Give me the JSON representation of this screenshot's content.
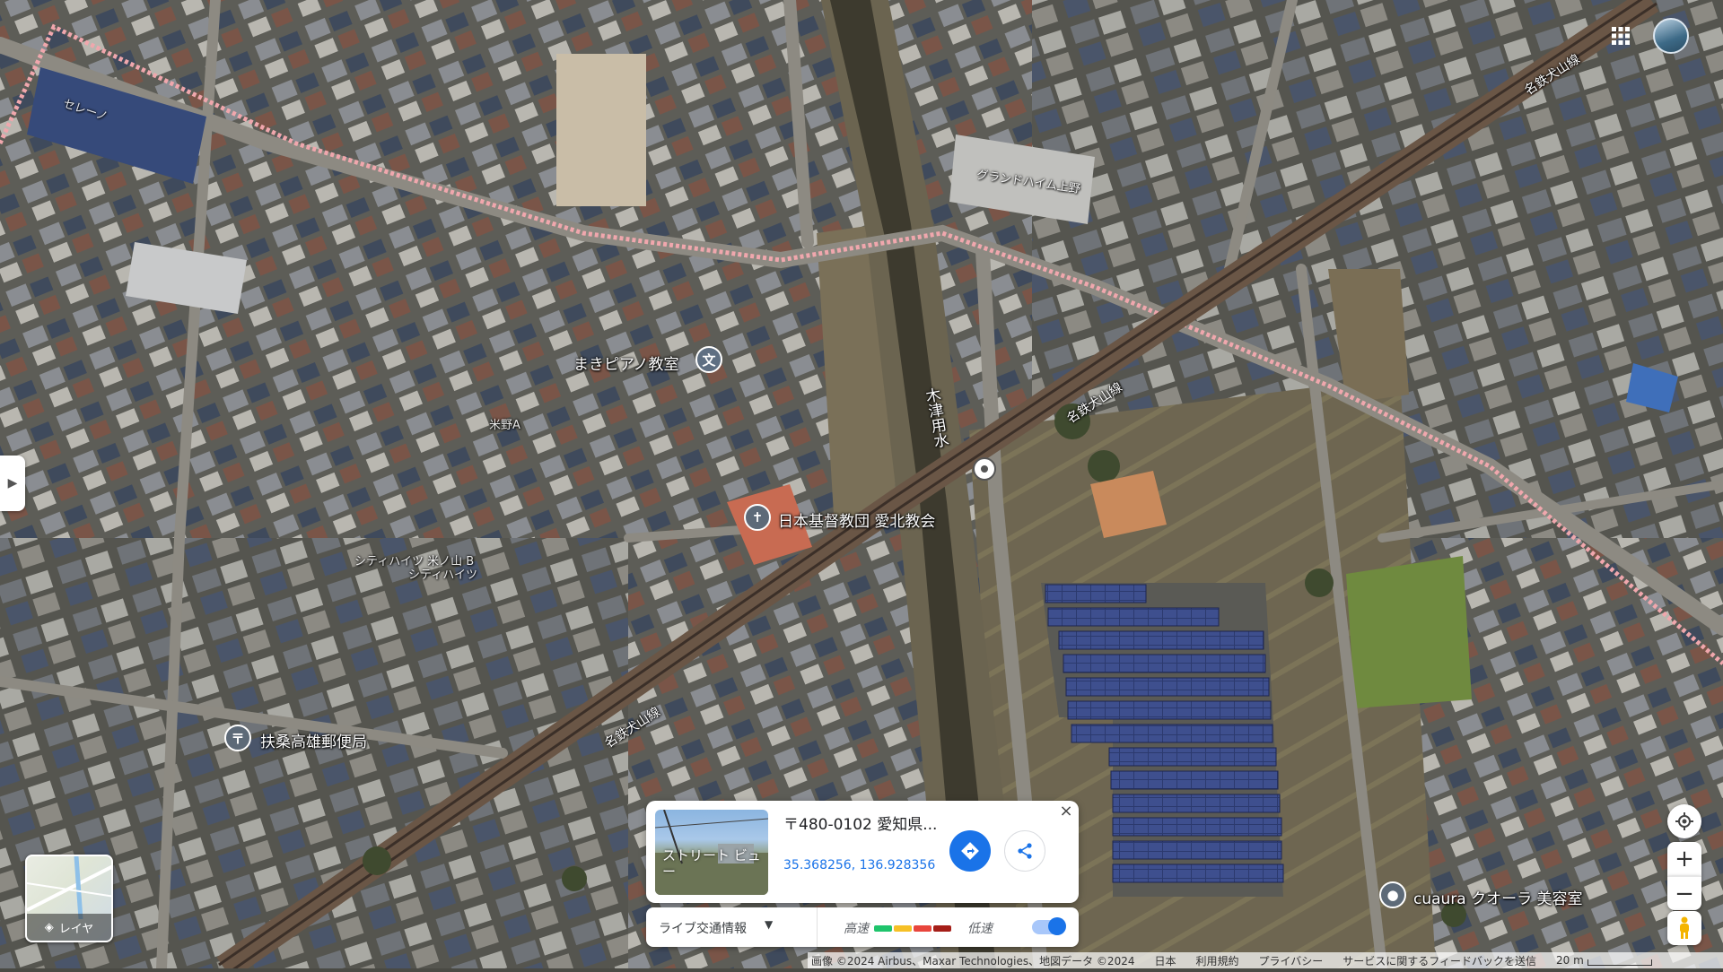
{
  "map": {
    "type": "satellite",
    "labels": {
      "piano_school": "まきピアノ教室",
      "church": "日本基督教団 愛北教会",
      "post_office": "扶桑高雄郵便局",
      "salon": "cuaura クオーラ 美容室",
      "canal": "木津用水",
      "rail_line_1": "名鉄犬山線",
      "rail_line_2": "名鉄犬山線",
      "rail_line_3": "名鉄犬山線",
      "building_1": "グランドハイム上野",
      "building_2": "シティハイツ 米ノ山 B",
      "building_3": "セレーノ",
      "building_4": "米野A",
      "building_5": "シティハイツ"
    },
    "icons": {
      "school": "school-icon",
      "church": "cross-icon",
      "post": "post-office-icon",
      "salon": "pin-icon"
    }
  },
  "info_card": {
    "address": "〒480-0102 愛知県...",
    "coordinates": "35.368256, 136.928356",
    "street_view_label": "ストリート ビュー",
    "close_label": "×"
  },
  "traffic": {
    "label": "ライブ交通情報",
    "fast": "高速",
    "slow": "低速",
    "colors": [
      "#1fc46c",
      "#f6c026",
      "#e8453c",
      "#a51e18"
    ],
    "enabled": true
  },
  "layers": {
    "label": "レイヤ"
  },
  "footer": {
    "attribution": "画像 ©2024 Airbus、Maxar Technologies、地図データ ©2024",
    "country": "日本",
    "terms": "利用規約",
    "privacy": "プライバシー",
    "feedback": "サービスに関するフィードバックを送信",
    "scale": "20 m"
  }
}
